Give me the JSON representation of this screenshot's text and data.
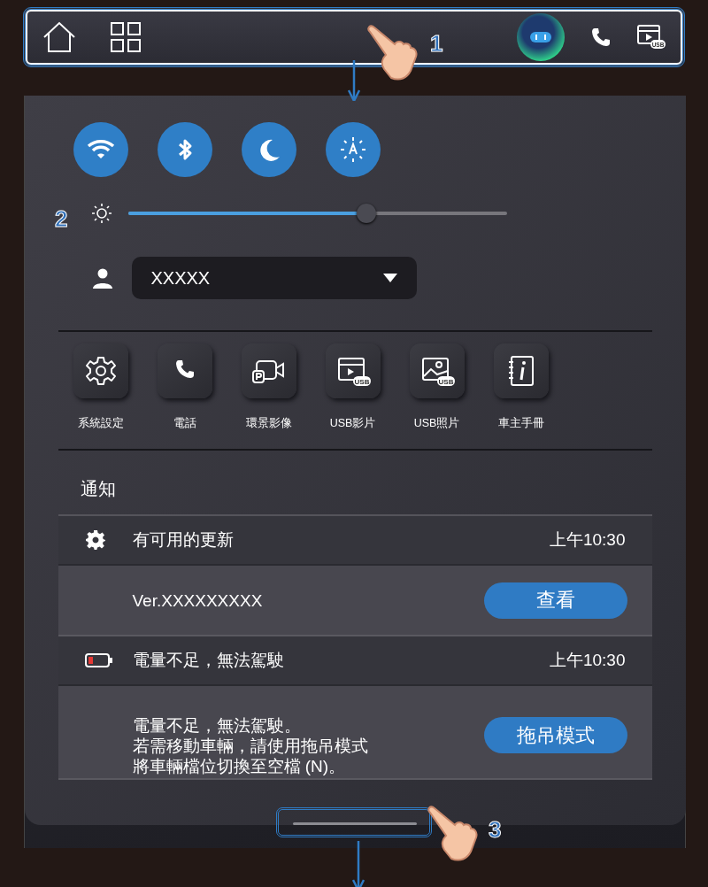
{
  "callouts": [
    "1",
    "2",
    "3"
  ],
  "top_bar": {
    "items": [
      {
        "kind": "home"
      },
      {
        "kind": "apps"
      },
      {
        "kind": "assistant"
      },
      {
        "kind": "phone"
      },
      {
        "kind": "usb_video",
        "badge": "USB"
      }
    ]
  },
  "quick_toggles": [
    {
      "on": true
    },
    {
      "on": true
    },
    {
      "on": true
    },
    {
      "on": true
    }
  ],
  "brightness": {
    "level": 0.63
  },
  "profile": {
    "value": "XXXXX"
  },
  "apps": [
    {
      "label": "系統設定"
    },
    {
      "label": "電話"
    },
    {
      "label": "環景影像"
    },
    {
      "label": "USB影片",
      "badge": "USB"
    },
    {
      "label": "USB照片",
      "badge": "USB"
    },
    {
      "label": "車主手冊"
    }
  ],
  "notifications": {
    "title": "通知",
    "items": [
      {
        "kind": "update",
        "title": "有可用的更新",
        "time": "上午10:30",
        "detail": [
          "Ver.XXXXXXXXX"
        ],
        "action": "查看"
      },
      {
        "kind": "battery",
        "title": "電量不足，無法駕駛",
        "time": "上午10:30",
        "detail": [
          "電量不足，無法駕駛。",
          "若需移動車輛，請使用拖吊模式",
          "將車輛檔位切換至空檔 (N)。"
        ],
        "action": "拖吊模式"
      }
    ]
  }
}
